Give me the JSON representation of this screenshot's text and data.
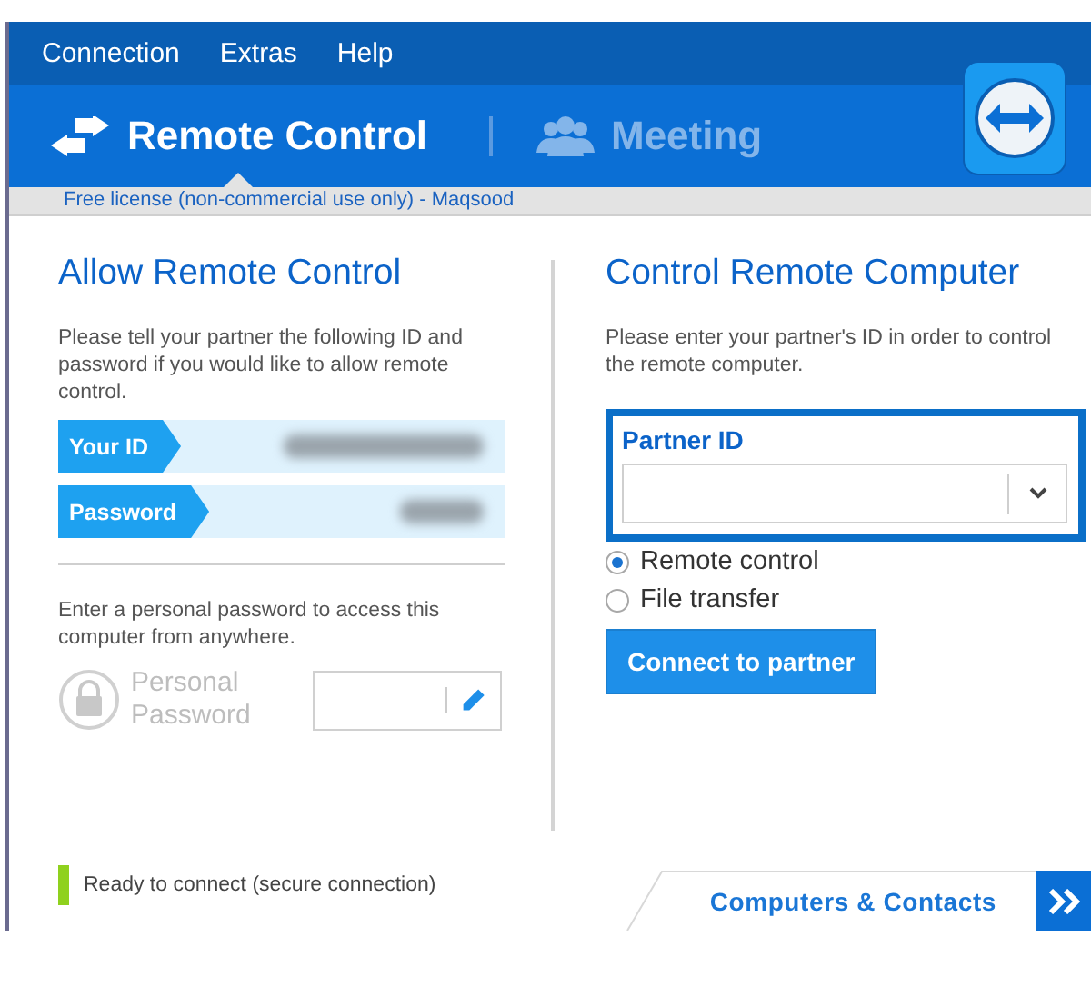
{
  "menu": [
    "Connection",
    "Extras",
    "Help"
  ],
  "tabs": [
    {
      "label": "Remote Control",
      "kind": "arrows",
      "selected": true
    },
    {
      "label": "Meeting",
      "kind": "people",
      "selected": false
    }
  ],
  "license": "Free license (non-commercial use only) - Maqsood",
  "allow": {
    "title": "Allow Remote Control",
    "description": "Please tell your partner the following ID and password if you would like to allow remote control.",
    "credentials": [
      {
        "label": "Your ID"
      },
      {
        "label": "Password"
      }
    ],
    "personal_description": "Enter a personal password to access this computer from anywhere.",
    "personal_label": "Personal Password"
  },
  "control": {
    "title": "Control Remote Computer",
    "description": "Please enter your partner's ID in order to control the remote computer.",
    "partner_label": "Partner ID",
    "options": [
      {
        "label": "Remote control",
        "selected": true
      },
      {
        "label": "File transfer",
        "selected": false
      }
    ],
    "button": "Connect to partner"
  },
  "status": {
    "text": "Ready to connect (secure connection)",
    "color": "#8fd11e"
  },
  "footer_tab": {
    "label": "Computers & Contacts"
  }
}
